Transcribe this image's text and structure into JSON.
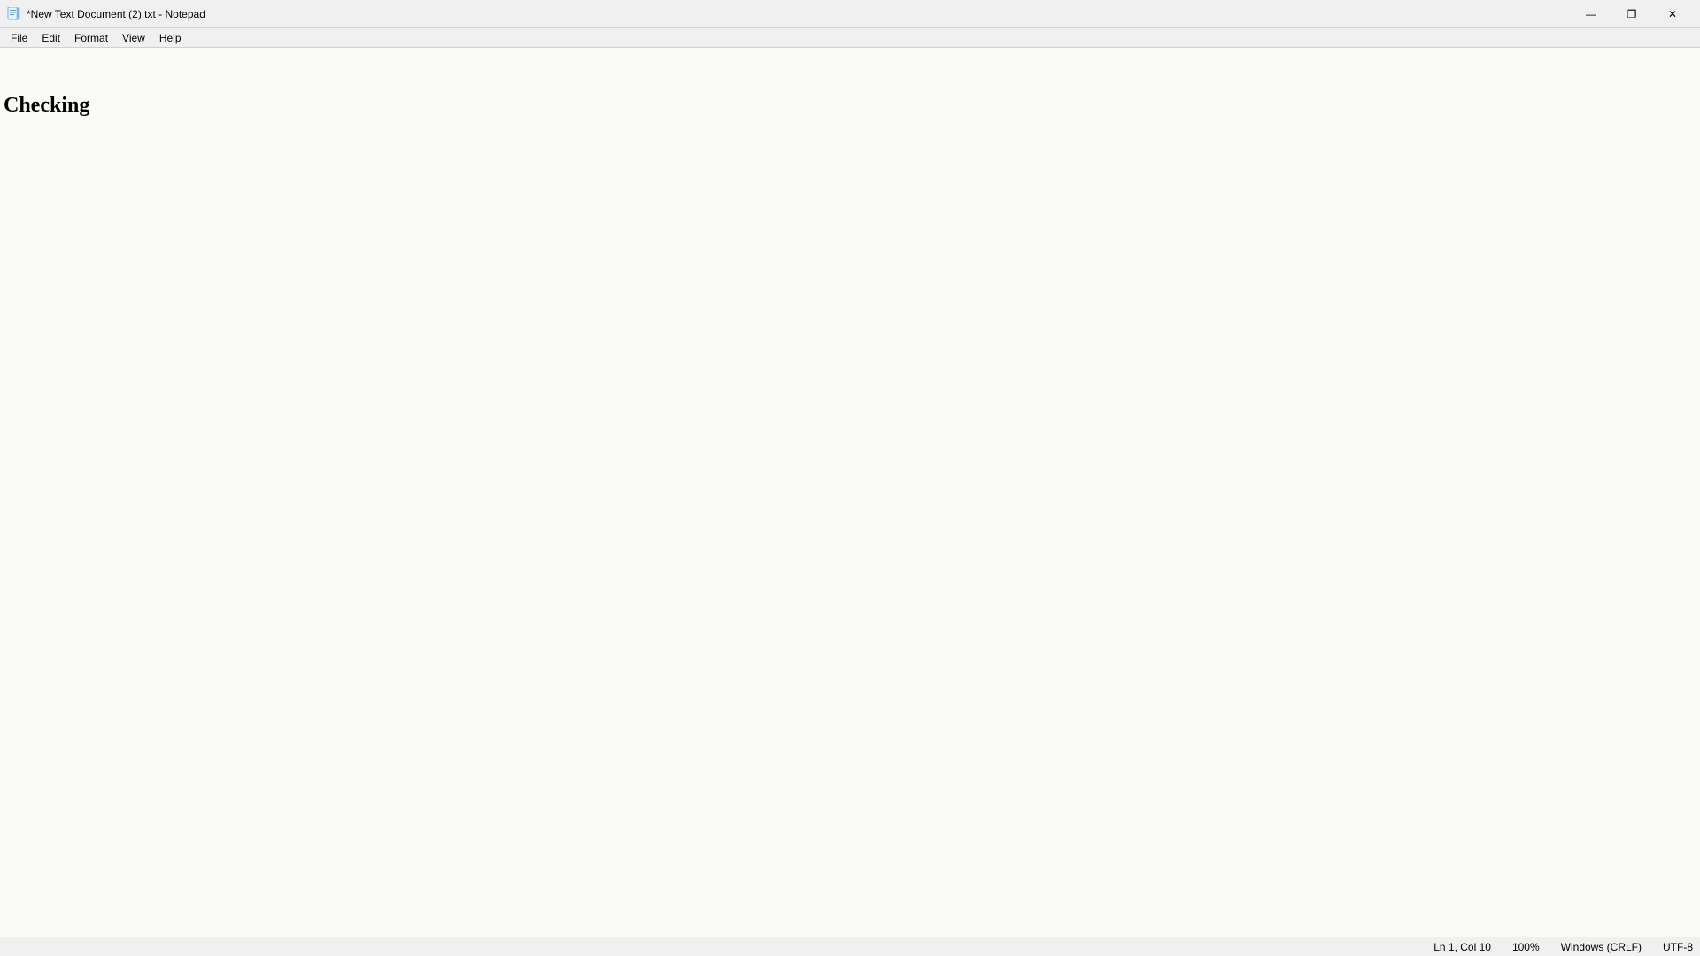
{
  "titlebar": {
    "title": "*New Text Document (2).txt - Notepad",
    "icon": "notepad-icon"
  },
  "window_controls": {
    "minimize_label": "—",
    "maximize_label": "❐",
    "close_label": "✕"
  },
  "menu": {
    "items": [
      {
        "id": "file",
        "label": "File"
      },
      {
        "id": "edit",
        "label": "Edit"
      },
      {
        "id": "format",
        "label": "Format"
      },
      {
        "id": "view",
        "label": "View"
      },
      {
        "id": "help",
        "label": "Help"
      }
    ]
  },
  "editor": {
    "content": "Checking"
  },
  "statusbar": {
    "position": "Ln 1, Col 10",
    "zoom": "100%",
    "line_ending": "Windows (CRLF)",
    "encoding": "UTF-8"
  }
}
